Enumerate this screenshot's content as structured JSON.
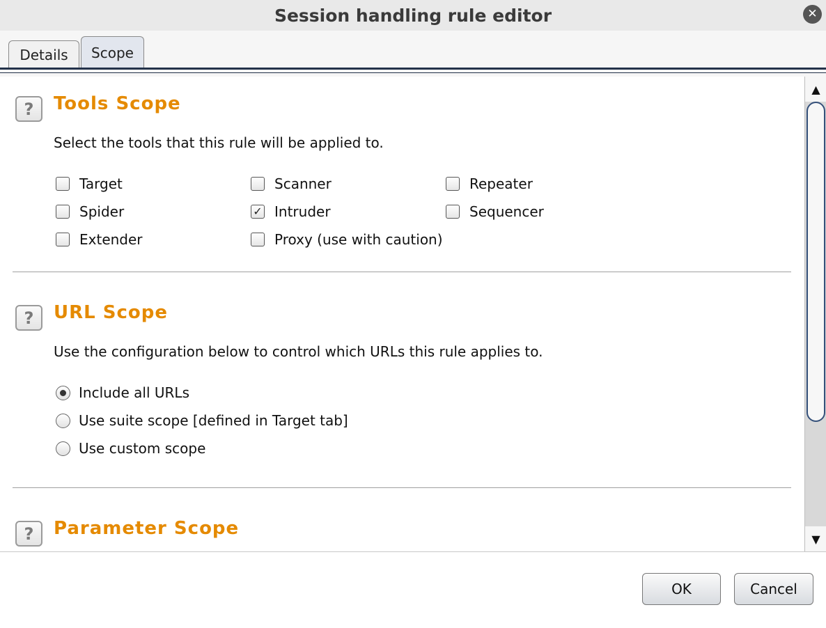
{
  "window": {
    "title": "Session handling rule editor",
    "close_glyph": "✕"
  },
  "tabs": [
    {
      "label": "Details",
      "active": false
    },
    {
      "label": "Scope",
      "active": true
    }
  ],
  "sections": {
    "tools": {
      "heading": "Tools Scope",
      "help_glyph": "?",
      "description": "Select the tools that this rule will be applied to.",
      "options": [
        {
          "label": "Target",
          "checked": false
        },
        {
          "label": "Scanner",
          "checked": false
        },
        {
          "label": "Repeater",
          "checked": false
        },
        {
          "label": "Spider",
          "checked": false
        },
        {
          "label": "Intruder",
          "checked": true
        },
        {
          "label": "Sequencer",
          "checked": false
        },
        {
          "label": "Extender",
          "checked": false
        },
        {
          "label": "Proxy (use with caution)",
          "checked": false
        }
      ]
    },
    "url": {
      "heading": "URL Scope",
      "help_glyph": "?",
      "description": "Use the configuration below to control which URLs this rule applies to.",
      "options": [
        {
          "label": "Include all URLs",
          "selected": true
        },
        {
          "label": "Use suite scope [defined in Target tab]",
          "selected": false
        },
        {
          "label": "Use custom scope",
          "selected": false
        }
      ]
    },
    "parameter": {
      "heading": "Parameter Scope",
      "help_glyph": "?"
    }
  },
  "scrollbar": {
    "up_glyph": "▲",
    "down_glyph": "▼"
  },
  "footer": {
    "ok_label": "OK",
    "cancel_label": "Cancel"
  },
  "colors": {
    "heading": "#e58a00",
    "accent": "#23324a",
    "thumb_border": "#34507a"
  }
}
